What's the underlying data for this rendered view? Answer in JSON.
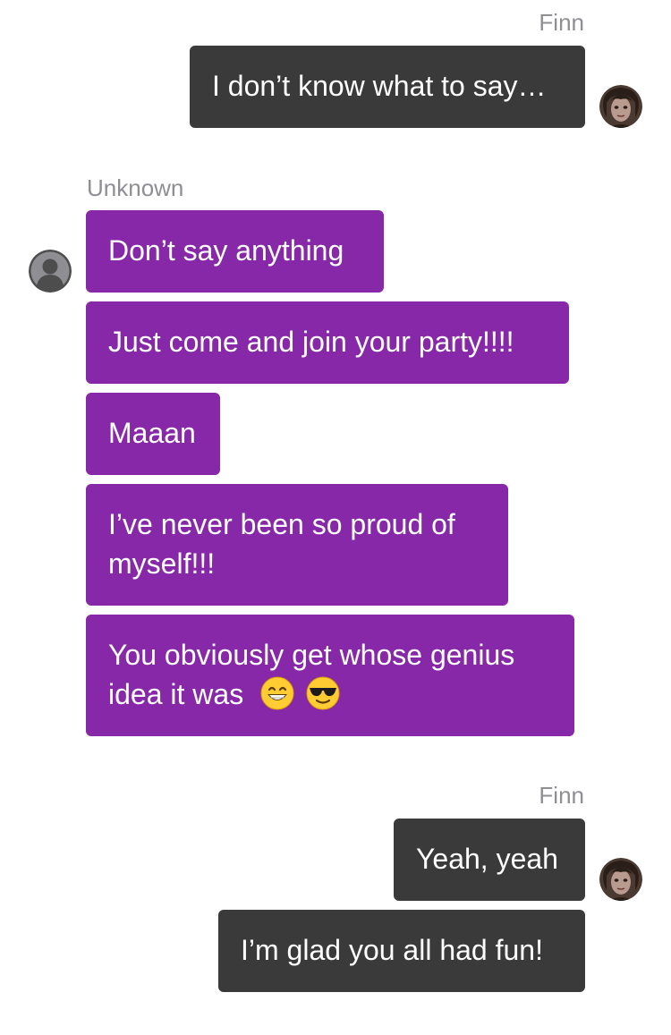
{
  "conversation": {
    "groups": [
      {
        "sender": "Finn",
        "messages": [
          "I don’t know what to say…"
        ]
      },
      {
        "sender": "Unknown",
        "messages": [
          "Don’t say anything",
          "Just come and join your party!!!!",
          "Maaan",
          [
            "I’ve never been so proud of",
            "myself!!!"
          ],
          [
            "You obviously get whose genius",
            "idea it was"
          ]
        ]
      },
      {
        "sender": "Finn",
        "messages": [
          "Yeah, yeah",
          "I’m glad you all had fun!"
        ]
      }
    ],
    "emojis": [
      "grinning-face-with-smiling-eyes",
      "smiling-face-with-sunglasses"
    ]
  },
  "colors": {
    "outgoing_bubble": "#3a3a3a",
    "incoming_bubble": "#8628a8",
    "sender_label": "#8e8e93",
    "bubble_text": "#ffffff"
  }
}
